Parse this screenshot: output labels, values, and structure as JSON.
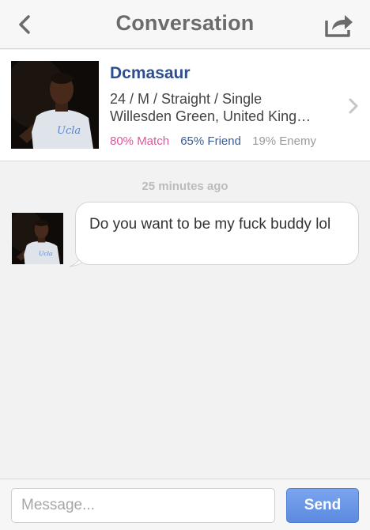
{
  "navbar": {
    "title": "Conversation",
    "back_icon": "chevron-left-icon",
    "share_icon": "share-icon"
  },
  "profile": {
    "name": "Dcmasaur",
    "details": "24 / M / Straight / Single",
    "location": "Willesden Green, United King…",
    "match": "80% Match",
    "friend": "65% Friend",
    "enemy": "19% Enemy",
    "chevron_icon": "chevron-right-icon"
  },
  "conversation": {
    "timestamp": "25 minutes ago",
    "messages": [
      {
        "text": "Do you want to be my fuck buddy lol"
      }
    ]
  },
  "composer": {
    "placeholder": "Message...",
    "value": "",
    "send_label": "Send"
  },
  "colors": {
    "name_blue": "#2f4e8f",
    "match_pink": "#e0569a",
    "friend_blue": "#3a5d9c",
    "enemy_gray": "#9a9a9a",
    "send_button": "#5b8be0"
  }
}
